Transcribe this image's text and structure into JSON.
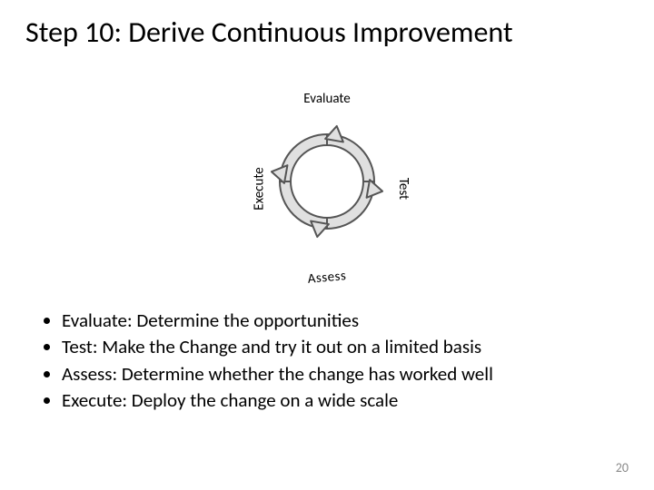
{
  "title": "Step 10: Derive Continuous Improvement",
  "cycle": {
    "top": "Evaluate",
    "right": "Test",
    "bottom": "Assess",
    "left": "Execute"
  },
  "bullets": [
    "Evaluate: Determine the opportunities",
    "Test: Make the Change and try it out on a limited basis",
    "Assess: Determine whether the change has worked well",
    "Execute: Deploy the change on a wide scale"
  ],
  "page_number": "20"
}
